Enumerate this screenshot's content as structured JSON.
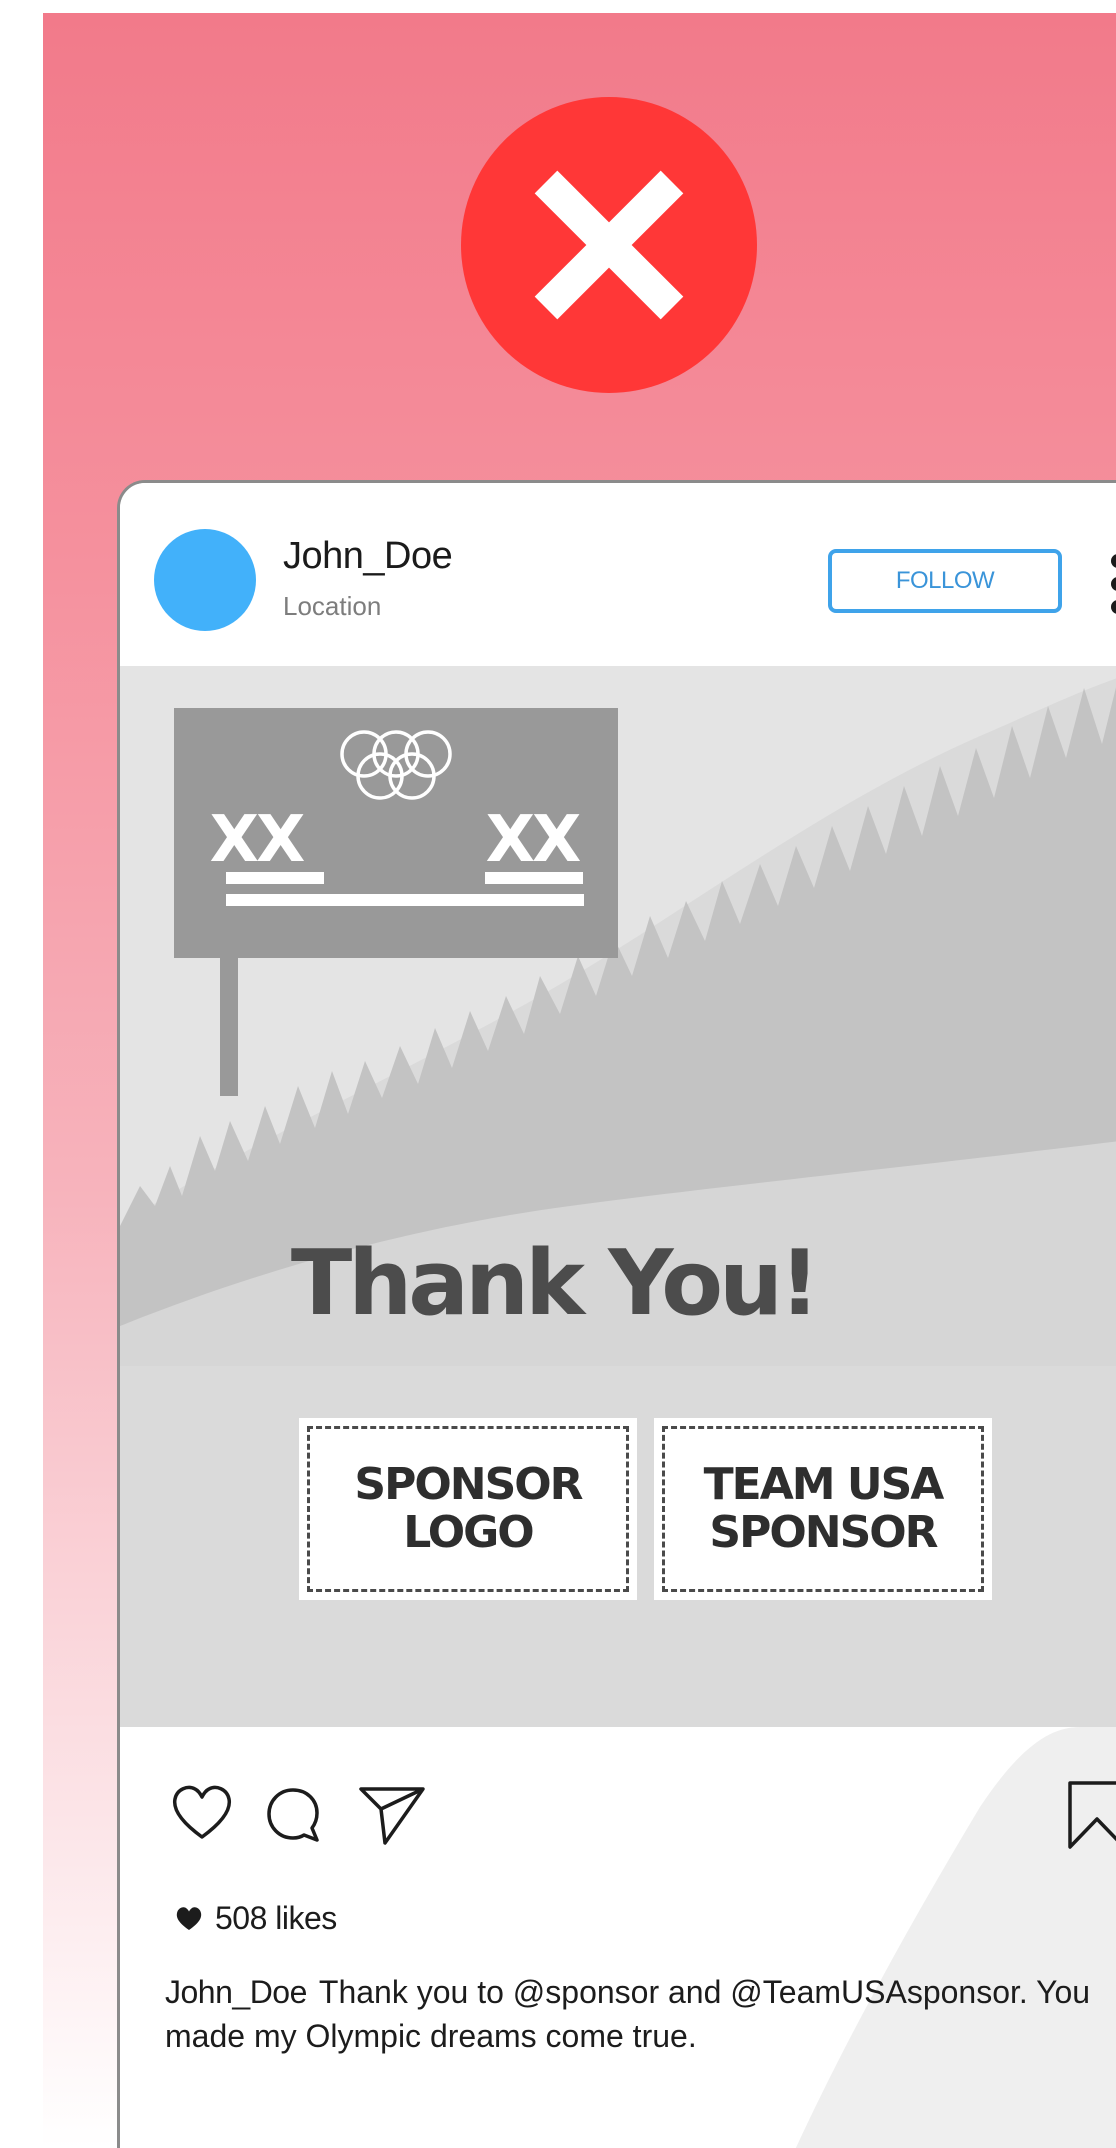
{
  "badge": {
    "icon": "close-icon",
    "color": "#ff3737"
  },
  "post": {
    "username": "John_Doe",
    "location": "Location",
    "follow_label": "FOLLOW",
    "image": {
      "headline": "Thank You!",
      "billboard_left": "XX",
      "billboard_right": "XX",
      "sponsors": [
        {
          "label": "SPONSOR\nLOGO"
        },
        {
          "label": "TEAM USA\nSPONSOR"
        }
      ]
    },
    "likes_text": "508 likes",
    "caption_user": "John_Doe",
    "caption_text": "Thank you to @sponsor and @TeamUSAsponsor. You made my Olympic dreams come true."
  },
  "colors": {
    "avatar": "#42b1fa",
    "follow_accent": "#3fa3ea",
    "background_top": "#f27a8a"
  }
}
